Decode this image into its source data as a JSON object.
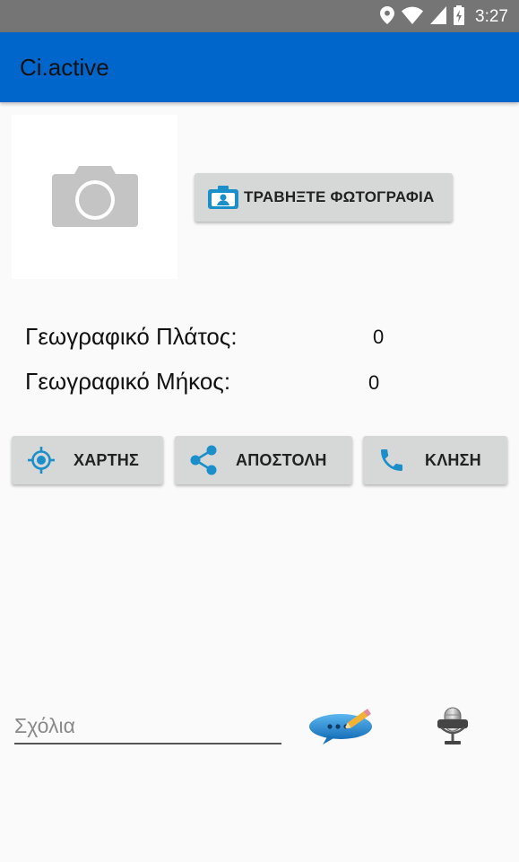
{
  "status_bar": {
    "time": "3:27",
    "icons": [
      "location-icon",
      "wifi-icon",
      "signal-icon",
      "battery-charging-icon"
    ]
  },
  "app_bar": {
    "title": "Ci.active"
  },
  "photo": {
    "placeholder_icon": "camera-icon",
    "take_photo_button": {
      "label": "ΤΡΑΒΗΞΤΕ ΦΩΤΟΓΡΑΦΙΑ",
      "icon": "camera-front-icon"
    }
  },
  "location": {
    "latitude_label": "Γεωγραφικό Πλάτος:",
    "latitude_value": "0",
    "longitude_label": "Γεωγραφικό Μήκος:",
    "longitude_value": "0"
  },
  "actions": {
    "map": {
      "label": "ΧΑΡΤΗΣ",
      "icon": "my-location-icon"
    },
    "send": {
      "label": "ΑΠΟΣΤΟΛΗ",
      "icon": "share-icon"
    },
    "call": {
      "label": "ΚΛΗΣΗ",
      "icon": "phone-icon"
    }
  },
  "comments": {
    "placeholder": "Σχόλια",
    "value": "",
    "edit_icon": "comment-edit-icon",
    "voice_icon": "microphone-icon"
  },
  "colors": {
    "app_bar": "#0066cc",
    "status_bar": "#757575",
    "accent_icon": "#1a8fc9",
    "button_bg": "#d6d7d7"
  }
}
